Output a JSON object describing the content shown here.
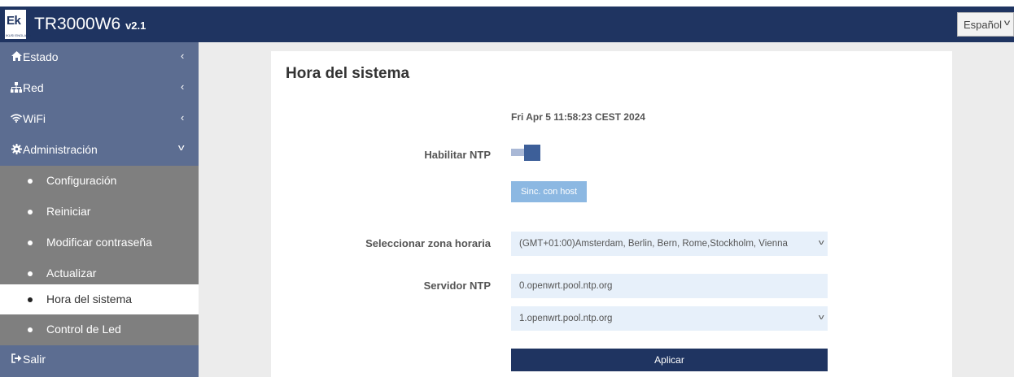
{
  "header": {
    "logo_text": "Ek",
    "logo_subtext": "IKUSI ENGLAND",
    "model": "TR3000W6",
    "version": "v2.1",
    "language": "Español"
  },
  "sidebar": {
    "items": [
      {
        "label": "Estado",
        "icon": "home-icon"
      },
      {
        "label": "Red",
        "icon": "network-icon"
      },
      {
        "label": "WiFi",
        "icon": "wifi-icon"
      },
      {
        "label": "Administración",
        "icon": "gear-icon"
      }
    ],
    "subitems": [
      {
        "label": "Configuración"
      },
      {
        "label": "Reiniciar"
      },
      {
        "label": "Modificar contraseña"
      },
      {
        "label": "Actualizar"
      },
      {
        "label": "Hora del sistema"
      },
      {
        "label": "Control de Led"
      }
    ],
    "logout": {
      "label": "Salir",
      "icon": "logout-icon"
    }
  },
  "main": {
    "title": "Hora del sistema",
    "current_time": "Fri Apr 5 11:58:23 CEST 2024",
    "ntp_label": "Habilitar NTP",
    "ntp_enabled": true,
    "sync_button": "Sinc. con host",
    "timezone_label": "Seleccionar zona horaria",
    "timezone_value": "(GMT+01:00)Amsterdam, Berlin, Bern, Rome,Stockholm, Vienna",
    "ntp_server_label": "Servidor NTP",
    "ntp_server_1": "0.openwrt.pool.ntp.org",
    "ntp_server_2": "1.openwrt.pool.ntp.org",
    "apply_button": "Aplicar"
  },
  "colors": {
    "header_bg": "#1f3461",
    "sidebar_bg": "#5c6d91",
    "submenu_bg": "#7f7f7f",
    "toggle_on": "#3d5f99",
    "sync_button_bg": "#8cb8e2",
    "input_bg": "#e7f0fa"
  }
}
